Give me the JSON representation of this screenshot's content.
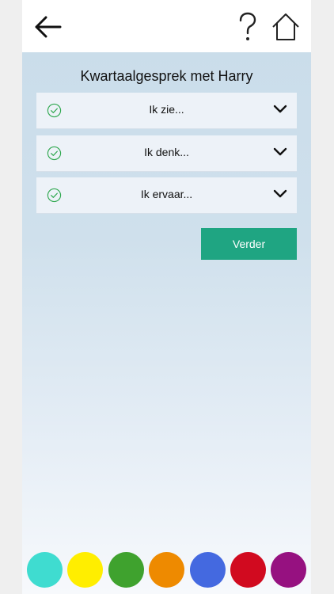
{
  "header": {
    "back_icon": "arrow-left-icon",
    "help_icon": "question-mark-icon",
    "home_icon": "home-icon"
  },
  "page": {
    "title": "Kwartaalgesprek met Harry"
  },
  "sections": [
    {
      "label": "Ik zie...",
      "status_icon": "check-circle-icon",
      "expand_icon": "chevron-down-icon"
    },
    {
      "label": "Ik denk...",
      "status_icon": "check-circle-icon",
      "expand_icon": "chevron-down-icon"
    },
    {
      "label": "Ik ervaar...",
      "status_icon": "check-circle-icon",
      "expand_icon": "chevron-down-icon"
    }
  ],
  "next_button": {
    "label": "Verder"
  },
  "color_palette": [
    {
      "name": "turquoise",
      "color": "#3fdcd0"
    },
    {
      "name": "yellow",
      "color": "#ffee00"
    },
    {
      "name": "green",
      "color": "#3fa22e"
    },
    {
      "name": "orange",
      "color": "#ee8a00"
    },
    {
      "name": "blue",
      "color": "#4469e0"
    },
    {
      "name": "red",
      "color": "#d10a1f"
    },
    {
      "name": "purple",
      "color": "#961180"
    }
  ],
  "colors": {
    "accent": "#1fa582",
    "check": "#2fa84f",
    "background": "#c9dcea"
  }
}
